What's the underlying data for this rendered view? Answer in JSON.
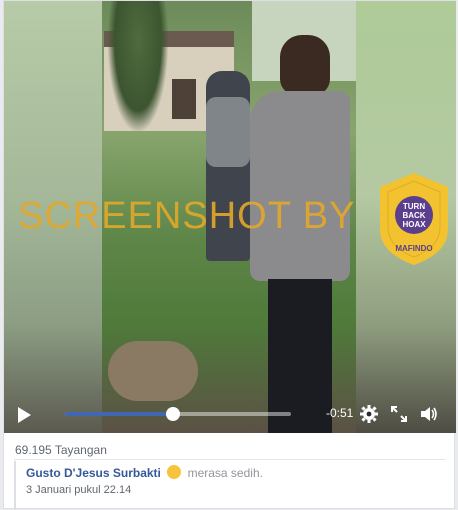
{
  "video": {
    "watermark_text": "SCREENSHOT BY",
    "badge": {
      "ring_text": "MASYARAKAT ANTI FITNAH INDONESIA",
      "center_line1": "TURN",
      "center_line2": "BACK",
      "center_line3": "HOAX",
      "bottom_text": "MAFINDO"
    },
    "controls": {
      "time_remaining": "-0:51",
      "progress": 0.48
    }
  },
  "post": {
    "views": "69.195 Tayangan",
    "comment": {
      "author": "Gusto D'Jesus Surbakti",
      "feeling": "merasa sedih.",
      "date": "3 Januari pukul 22.14"
    }
  },
  "colors": {
    "accent": "#4267b2",
    "link": "#365899",
    "watermark": "#e4a82a",
    "badge_yellow": "#f2c230",
    "badge_purple": "#5b3f8e"
  },
  "icons": [
    "play-icon",
    "gear-icon",
    "fullscreen-icon",
    "volume-icon",
    "sad-emoji-icon"
  ]
}
